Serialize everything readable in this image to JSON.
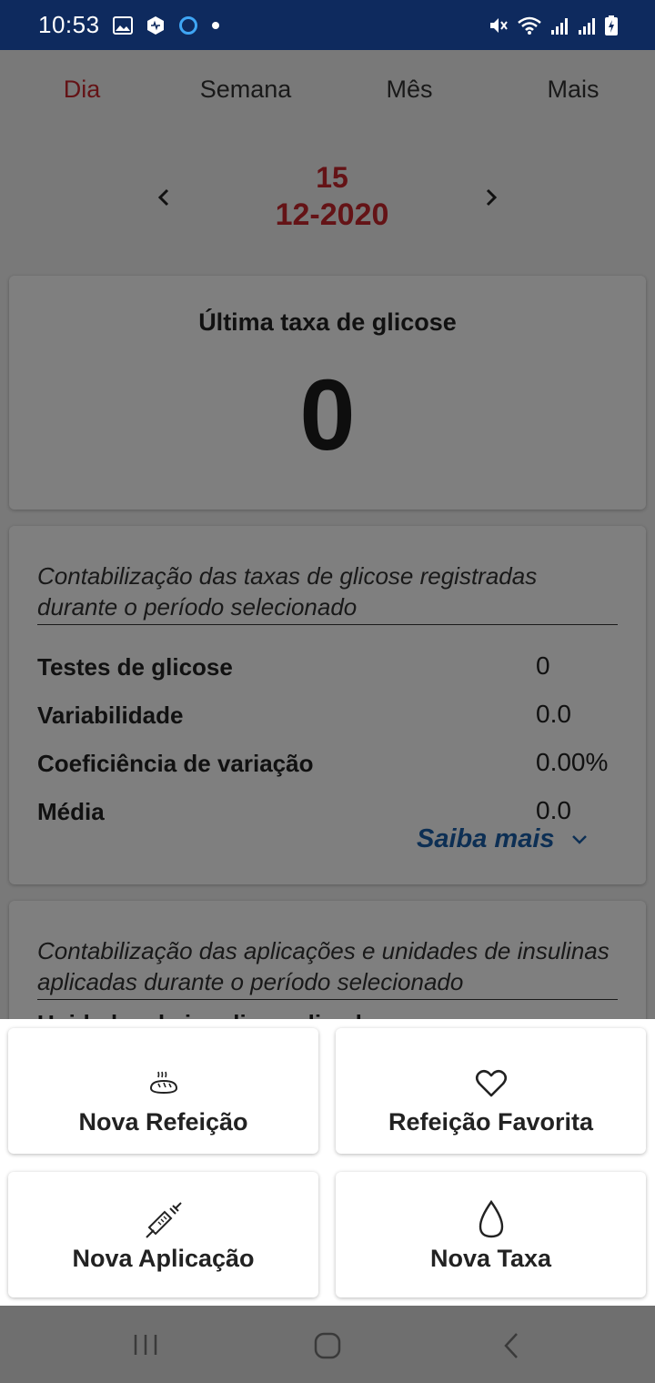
{
  "status_bar": {
    "time": "10:53",
    "left_icons": [
      "image-icon",
      "app-badge-icon",
      "circle-icon",
      "dot-icon"
    ],
    "right_icons": [
      "mute-icon",
      "wifi-icon",
      "signal-icon",
      "signal-icon",
      "battery-icon"
    ]
  },
  "tabs": [
    {
      "label": "Dia",
      "active": true
    },
    {
      "label": "Semana",
      "active": false
    },
    {
      "label": "Mês",
      "active": false
    },
    {
      "label": "Mais",
      "active": false
    }
  ],
  "date": {
    "day": "15",
    "month_year": "12-2020"
  },
  "glucose_card": {
    "label": "Última taxa de glicose",
    "value": "0"
  },
  "stats_card": {
    "caption": "Contabilização das taxas de glicose registradas durante o período selecionado",
    "rows": [
      {
        "name": "Testes de glicose",
        "value": "0"
      },
      {
        "name": "Variabilidade",
        "value": "0.0"
      },
      {
        "name": "Coeficiência de variação",
        "value": "0.00%"
      },
      {
        "name": "Média",
        "value": "0.0"
      }
    ],
    "learn_more": "Saiba mais"
  },
  "insulin_card": {
    "caption": "Contabilização das aplicações e unidades de insulinas aplicadas durante o período selecionado",
    "row_partial": "Unidades de insulina aplicadas"
  },
  "actions": [
    {
      "label": "Nova Refeição",
      "icon": "bread-icon"
    },
    {
      "label": "Refeição Favorita",
      "icon": "heart-icon"
    },
    {
      "label": "Nova Aplicação",
      "icon": "syringe-icon"
    },
    {
      "label": "Nova Taxa",
      "icon": "drop-icon"
    }
  ],
  "colors": {
    "status_bar": "#0e2a5e",
    "accent_red": "#c8262c",
    "link_blue": "#1a5fa8"
  }
}
